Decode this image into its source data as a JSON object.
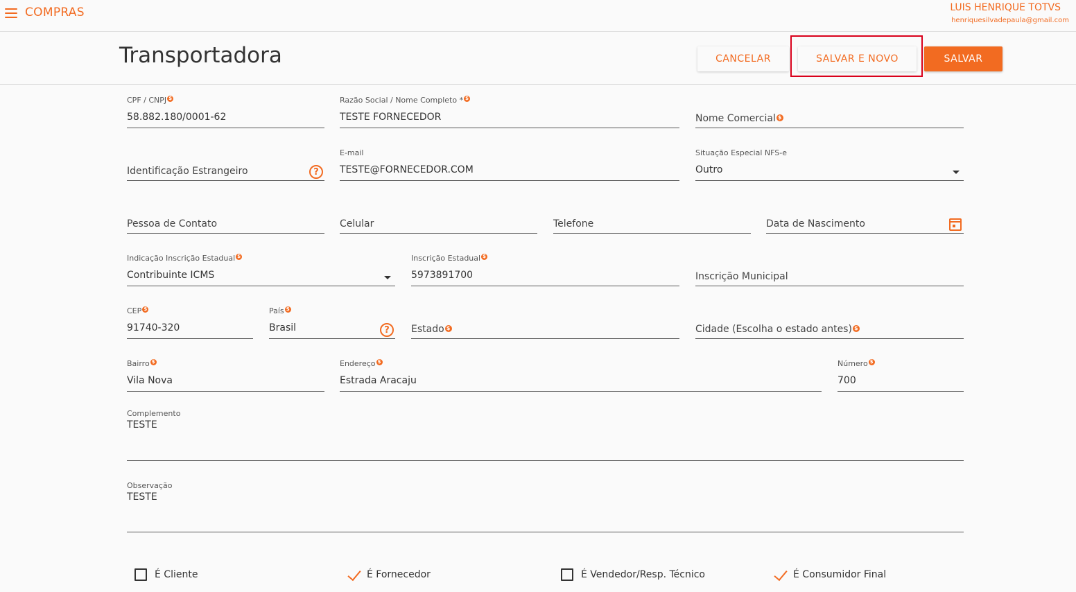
{
  "topbar": {
    "app_title": "COMPRAS",
    "user_name": "LUIS HENRIQUE TOTVS",
    "user_email": "henriquesilvadepaula@gmail.com"
  },
  "header": {
    "title": "Transportadora",
    "cancel_label": "CANCELAR",
    "save_new_label": "SALVAR E NOVO",
    "save_label": "SALVAR"
  },
  "form": {
    "cpf": {
      "label": "CPF / CNPJ",
      "value": "58.882.180/0001-62"
    },
    "razao": {
      "label": "Razão Social / Nome Completo *",
      "value": "TESTE FORNECEDOR"
    },
    "nome_comercial": {
      "label": "Nome Comercial"
    },
    "id_estrangeiro": {
      "label": "Identificação Estrangeiro"
    },
    "email": {
      "label": "E-mail",
      "value": "TESTE@FORNECEDOR.COM"
    },
    "situacao": {
      "label": "Situação Especial NFS-e",
      "value": "Outro"
    },
    "contato": {
      "label": "Pessoa de Contato"
    },
    "celular": {
      "label": "Celular"
    },
    "telefone": {
      "label": "Telefone"
    },
    "nascimento": {
      "label": "Data de Nascimento"
    },
    "ind_ie": {
      "label": "Indicação Inscrição Estadual",
      "value": "Contribuinte ICMS"
    },
    "ie": {
      "label": "Inscrição Estadual",
      "value": "5973891700"
    },
    "im": {
      "label": "Inscrição Municipal"
    },
    "cep": {
      "label": "CEP",
      "value": "91740-320"
    },
    "pais": {
      "label": "País",
      "value": "Brasil"
    },
    "estado": {
      "label": "Estado"
    },
    "cidade": {
      "label": "Cidade (Escolha o estado antes)"
    },
    "bairro": {
      "label": "Bairro",
      "value": "Vila Nova"
    },
    "endereco": {
      "label": "Endereço",
      "value": "Estrada Aracaju"
    },
    "numero": {
      "label": "Número",
      "value": "700"
    },
    "complemento": {
      "label": "Complemento",
      "value": "TESTE"
    },
    "observacao": {
      "label": "Observação",
      "value": "TESTE"
    }
  },
  "required_glyph": "$",
  "help_glyph": "?",
  "checks": [
    {
      "label": "É Cliente",
      "checked": false
    },
    {
      "label": "É Fornecedor",
      "checked": true
    },
    {
      "label": "É Vendedor/Resp. Técnico",
      "checked": false
    },
    {
      "label": "É Consumidor Final",
      "checked": true
    }
  ],
  "colors": {
    "accent": "#f26b21",
    "highlight_border": "#d9001b"
  }
}
